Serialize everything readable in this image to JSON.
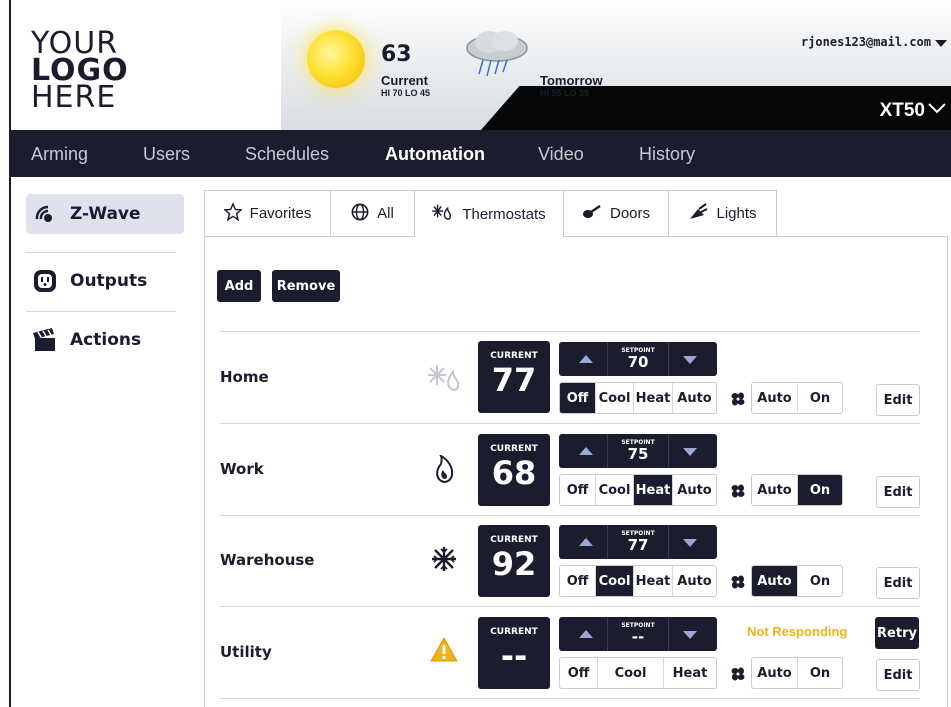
{
  "header": {
    "logo": [
      "YOUR",
      "LOGO",
      "HERE"
    ],
    "weather": {
      "current_temp": "63",
      "current_label": "Current",
      "current_hilo": "HI 70   LO 45",
      "tomorrow_label": "Tomorrow",
      "tomorrow_hilo": "HI 55   LO 39",
      "current_icon": "sun-icon",
      "tomorrow_icon": "rain-cloud-icon"
    },
    "user_email": "rjones123@mail.com",
    "panel_name": "XT50"
  },
  "nav": {
    "items": [
      {
        "label": "Arming",
        "active": false
      },
      {
        "label": "Users",
        "active": false
      },
      {
        "label": "Schedules",
        "active": false
      },
      {
        "label": "Automation",
        "active": true
      },
      {
        "label": "Video",
        "active": false
      },
      {
        "label": "History",
        "active": false
      }
    ]
  },
  "sidebar": {
    "items": [
      {
        "label": "Z-Wave",
        "icon": "zwave-icon",
        "active": true
      },
      {
        "label": "Outputs",
        "icon": "outlet-icon",
        "active": false
      },
      {
        "label": "Actions",
        "icon": "clapperboard-icon",
        "active": false
      }
    ]
  },
  "tabs": [
    {
      "label": "Favorites",
      "icon": "star-icon",
      "active": false
    },
    {
      "label": "All",
      "icon": "globe-icon",
      "active": false
    },
    {
      "label": "Thermostats",
      "icon": "snow-flame-icon",
      "active": true
    },
    {
      "label": "Doors",
      "icon": "key-icon",
      "active": false
    },
    {
      "label": "Lights",
      "icon": "light-icon",
      "active": false
    }
  ],
  "toolbar": {
    "add_label": "Add",
    "remove_label": "Remove"
  },
  "labels": {
    "current": "CURRENT",
    "setpoint": "SETPOINT",
    "edit": "Edit",
    "retry": "Retry",
    "not_responding": "Not Responding"
  },
  "thermostats": [
    {
      "name": "Home",
      "mode_icon": "auto-mode-icon",
      "current": "77",
      "setpoint": "70",
      "modes": [
        "Off",
        "Cool",
        "Heat",
        "Auto"
      ],
      "active_mode": "Off",
      "fan_modes": [
        "Auto",
        "On"
      ],
      "active_fan": ""
    },
    {
      "name": "Work",
      "mode_icon": "flame-icon",
      "current": "68",
      "setpoint": "75",
      "modes": [
        "Off",
        "Cool",
        "Heat",
        "Auto"
      ],
      "active_mode": "Heat",
      "fan_modes": [
        "Auto",
        "On"
      ],
      "active_fan": "On"
    },
    {
      "name": "Warehouse",
      "mode_icon": "snowflake-icon",
      "current": "92",
      "setpoint": "77",
      "modes": [
        "Off",
        "Cool",
        "Heat",
        "Auto"
      ],
      "active_mode": "Cool",
      "fan_modes": [
        "Auto",
        "On"
      ],
      "active_fan": "Auto"
    },
    {
      "name": "Utility",
      "mode_icon": "warning-icon",
      "current": "--",
      "setpoint": "--",
      "modes": [
        "Off",
        "Cool",
        "Heat"
      ],
      "active_mode": "",
      "fan_modes": [
        "Auto",
        "On"
      ],
      "active_fan": ""
    }
  ],
  "colors": {
    "navy": "#1b1d2e",
    "warning": "#f1b31c",
    "sidebar_active": "#dfe2ee"
  }
}
